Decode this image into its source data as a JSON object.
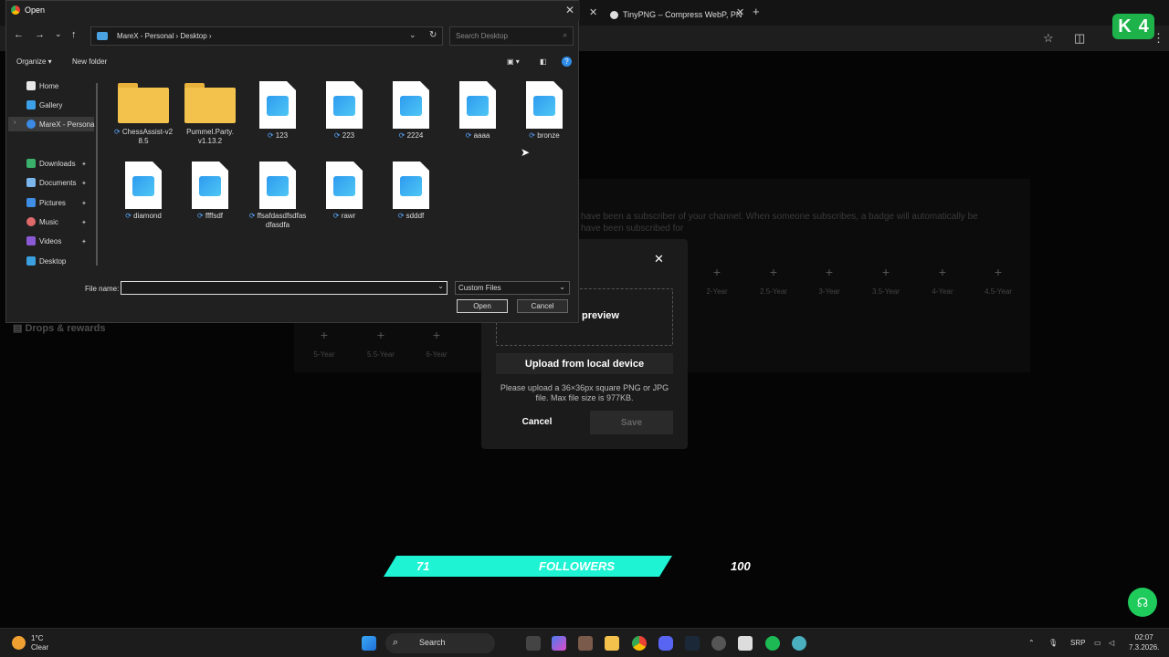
{
  "browser": {
    "tab_title": "TinyPNG – Compress WebP, PN",
    "tab_close": "✕",
    "new_tab": "+"
  },
  "k4": {
    "letter": "K",
    "number": "4"
  },
  "page": {
    "sidebar_drops": "Drops & rewards",
    "subscriber_text": "have been a subscriber of your channel. When someone subscribes, a badge will automatically be",
    "subscriber_text2": "have been subscribed for",
    "badges_row1": [
      "2-Year",
      "2.5-Year",
      "3-Year",
      "3.5-Year",
      "4-Year",
      "4.5-Year"
    ],
    "badges_row2": [
      "5-Year",
      "5.5-Year",
      "6-Year"
    ]
  },
  "modal": {
    "close": "✕",
    "preview_label": "preview",
    "upload_button": "Upload from local device",
    "upload_hint": "Please upload a 36×36px square PNG or JPG file. Max file size is 977KB.",
    "cancel": "Cancel",
    "save": "Save"
  },
  "followers": {
    "current": "71",
    "label": "FOLLOWERS",
    "goal": "100",
    "accent": "#1ef3d4"
  },
  "dialog": {
    "title": "Open",
    "close": "✕",
    "address": "MareX - Personal  ›  Desktop  ›",
    "search_placeholder": "Search Desktop",
    "organize": "Organize ▾",
    "new_folder": "New folder",
    "nav": {
      "home": "Home",
      "gallery": "Gallery",
      "marex": "MareX - Persona",
      "downloads": "Downloads",
      "documents": "Documents",
      "pictures": "Pictures",
      "music": "Music",
      "videos": "Videos",
      "desktop": "Desktop"
    },
    "files": [
      {
        "name": "ChessAssist-v2 8.5",
        "type": "folder",
        "sync": true
      },
      {
        "name": "Pummel.Party. v1.13.2",
        "type": "folder",
        "sync": false
      },
      {
        "name": "123",
        "type": "image",
        "sync": true
      },
      {
        "name": "223",
        "type": "image",
        "sync": true
      },
      {
        "name": "2224",
        "type": "image",
        "sync": true
      },
      {
        "name": "aaaa",
        "type": "image",
        "sync": true
      },
      {
        "name": "bronze",
        "type": "image",
        "sync": true
      },
      {
        "name": "diamond",
        "type": "image",
        "sync": true
      },
      {
        "name": "ffffsdf",
        "type": "image",
        "sync": true
      },
      {
        "name": "ffsafdasdfsdfas dfasdfa",
        "type": "image",
        "sync": true
      },
      {
        "name": "rawr",
        "type": "image",
        "sync": true
      },
      {
        "name": "sdddf",
        "type": "image",
        "sync": true
      }
    ],
    "filename_label": "File name:",
    "filename_value": "",
    "filetype": "Custom Files",
    "open": "Open",
    "cancel": "Cancel"
  },
  "taskbar": {
    "temp": "1°C",
    "weather": "Clear",
    "search": "Search",
    "lang": "SRP",
    "time": "02:07",
    "date": "7.3.2026."
  }
}
